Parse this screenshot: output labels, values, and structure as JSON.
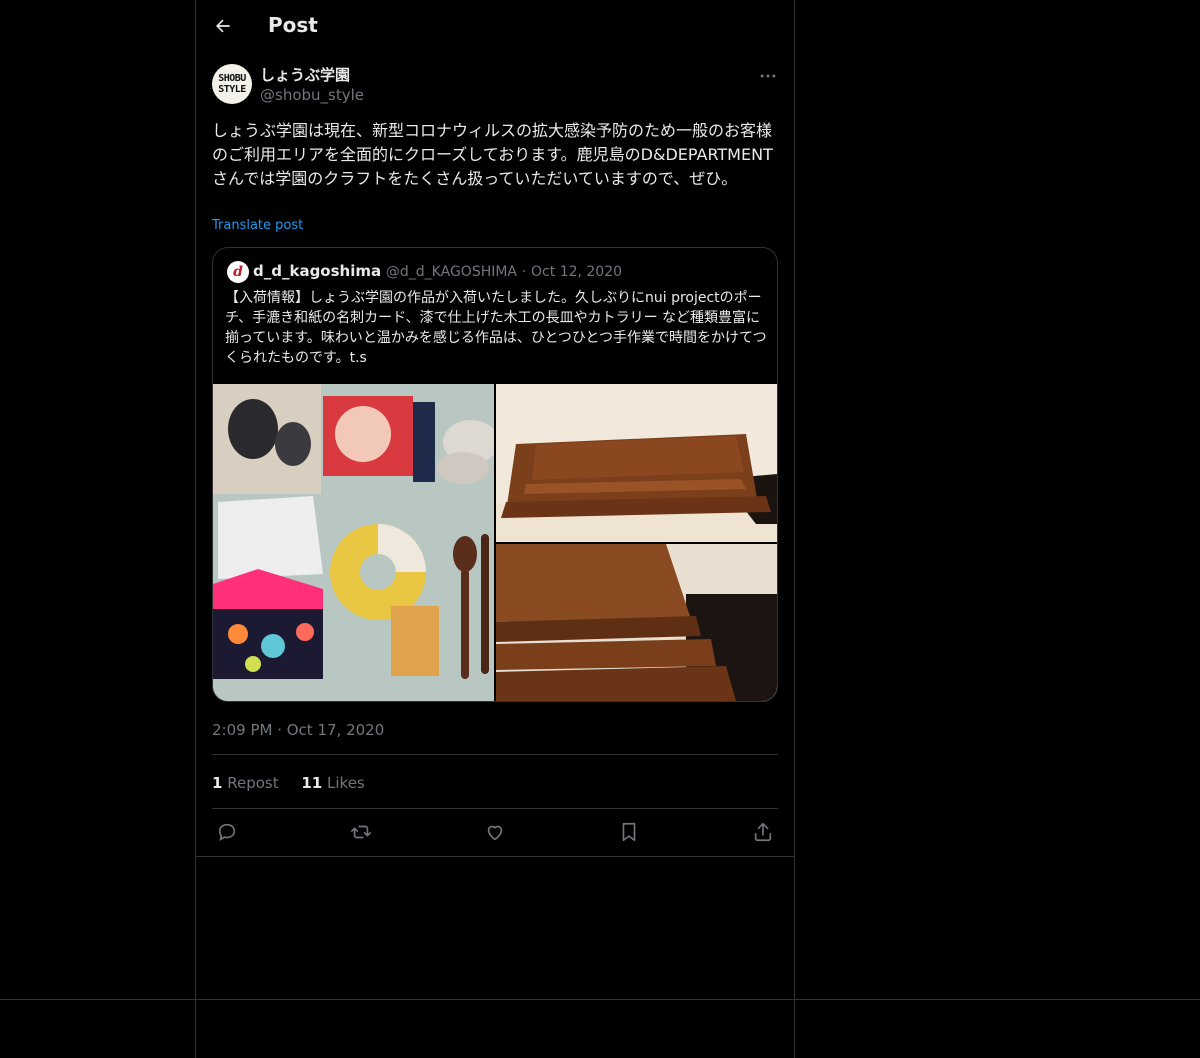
{
  "header": {
    "title": "Post",
    "back_icon": "arrow-left-icon"
  },
  "post": {
    "author_name": "しょうぶ学園",
    "author_handle": "@shobu_style",
    "avatar_text": "SHOBU\nSTYLE",
    "text": "しょうぶ学園は現在、新型コロナウィルスの拡大感染予防のため一般のお客様のご利用エリアを全面的にクローズしております。鹿児島のD&DEPARTMENTさんでは学園のクラフトをたくさん扱っていただいていますので、ぜひ。",
    "translate_label": "Translate post",
    "timestamp": "2:09 PM · Oct 17, 2020",
    "reposts_count": "1",
    "reposts_label": "Repost",
    "likes_count": "11",
    "likes_label": "Likes"
  },
  "quote": {
    "author_name": "d_d_kagoshima",
    "author_handle": "@d_d_KAGOSHIMA",
    "separator": "·",
    "date": "Oct 12, 2020",
    "avatar_letter": "d",
    "text": "【入荷情報】しょうぶ学園の作品が入荷いたしました。久しぶりにnui projectのポーチ、手漉き和紙の名刺カード、漆で仕上げた木工の長皿やカトラリー など種類豊富に揃っています。味わいと温かみを感じる作品は、ひとつひとつ手作業で時間をかけてつくられたものです。t.s"
  },
  "colors": {
    "accent": "#1d9bf0",
    "muted": "#71767b",
    "text": "#e7e9ea",
    "border": "#2f3336",
    "background": "#000000"
  },
  "actions": [
    "reply-icon",
    "repost-icon",
    "like-icon",
    "bookmark-icon",
    "share-icon"
  ]
}
